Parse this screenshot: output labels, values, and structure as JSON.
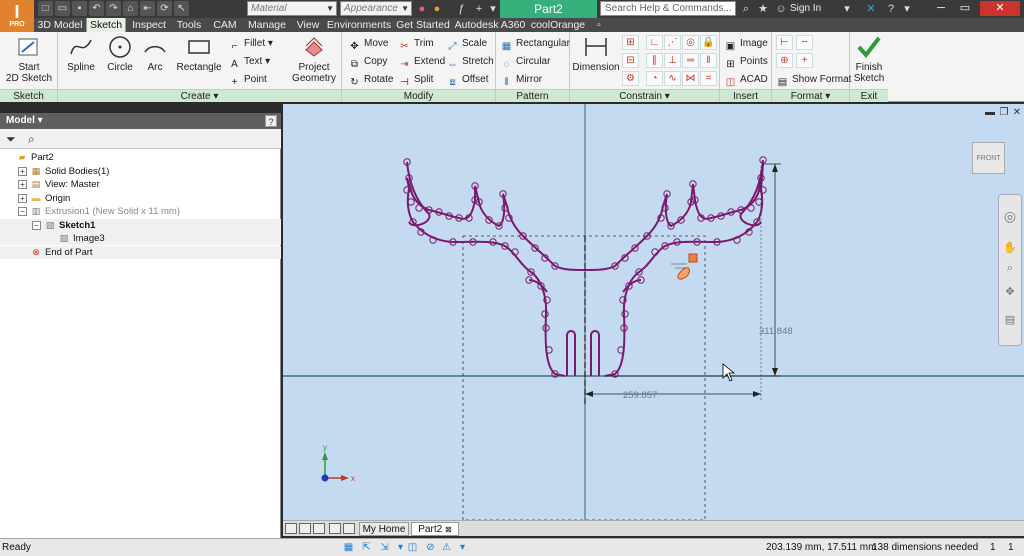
{
  "app": {
    "button_big": "I",
    "button_small": "PRO",
    "qat_icons": [
      "new-icon",
      "open-icon",
      "save-icon",
      "undo-icon",
      "redo-icon",
      "home-icon",
      "return-icon",
      "update-icon",
      "select-icon"
    ],
    "material_value": "Material",
    "appearance_value": "Appearance",
    "document_title": "Part2",
    "search_placeholder": "Search Help & Commands...",
    "sign_in_label": "Sign In"
  },
  "ribbon_tabs": [
    {
      "label": "3D Model"
    },
    {
      "label": "Sketch",
      "active": true
    },
    {
      "label": "Inspect"
    },
    {
      "label": "Tools"
    },
    {
      "label": "CAM"
    },
    {
      "label": "Manage"
    },
    {
      "label": "View"
    },
    {
      "label": "Environments"
    },
    {
      "label": "Get Started"
    },
    {
      "label": "Autodesk A360"
    },
    {
      "label": "coolOrange"
    }
  ],
  "ribbon": {
    "sketch_panel": {
      "label": "Sketch",
      "start_sketch_line1": "Start",
      "start_sketch_line2": "2D Sketch",
      "dropdown": "▾"
    },
    "create_panel": {
      "label": "Create ▾",
      "spline": "Spline",
      "circle": "Circle",
      "arc": "Arc",
      "rectangle": "Rectangle",
      "fillet": "Fillet",
      "text": "Text",
      "point": "Point",
      "project_geometry_line1": "Project",
      "project_geometry_line2": "Geometry"
    },
    "modify_panel": {
      "label": "Modify",
      "move": "Move",
      "copy": "Copy",
      "rotate": "Rotate",
      "trim": "Trim",
      "extend": "Extend",
      "split": "Split",
      "scale": "Scale",
      "stretch": "Stretch",
      "offset": "Offset"
    },
    "pattern_panel": {
      "label": "Pattern",
      "rectangular": "Rectangular",
      "circular": "Circular",
      "mirror": "Mirror"
    },
    "constrain_panel": {
      "label": "Constrain ▾",
      "dimension": "Dimension"
    },
    "insert_panel": {
      "label": "Insert",
      "image": "Image",
      "points": "Points",
      "acad": "ACAD"
    },
    "format_panel": {
      "label": "Format ▾",
      "show_format": "Show Format"
    },
    "exit_panel": {
      "label": "Exit",
      "finish_line1": "Finish",
      "finish_line2": "Sketch"
    }
  },
  "browser": {
    "title": "Model ▾",
    "help": "?",
    "tree": [
      {
        "label": "Part2",
        "icon": "part-icon",
        "indent": 0,
        "expander": ""
      },
      {
        "label": "Solid Bodies(1)",
        "icon": "solid-bodies-icon",
        "indent": 1,
        "expander": "+"
      },
      {
        "label": "View: Master",
        "icon": "view-icon",
        "indent": 1,
        "expander": "+"
      },
      {
        "label": "Origin",
        "icon": "folder-icon",
        "indent": 1,
        "expander": "+"
      },
      {
        "label": "Extrusion1 (New Solid x 11 mm)",
        "icon": "extrusion-icon",
        "indent": 1,
        "expander": "−",
        "muted": true
      },
      {
        "label": "Sketch1",
        "icon": "sketch-icon",
        "indent": 2,
        "expander": "−",
        "bold": true
      },
      {
        "label": "Image3",
        "icon": "image-icon",
        "indent": 3,
        "expander": ""
      },
      {
        "label": "End of Part",
        "icon": "end-of-part-icon",
        "indent": 1,
        "expander": ""
      }
    ]
  },
  "canvas": {
    "dim_vertical": "311.848",
    "dim_horizontal": "259.857",
    "viewcube_face": "FRONT",
    "axis_x": "x",
    "axis_y": "y"
  },
  "doc_tabs": [
    {
      "label": "My Home"
    },
    {
      "label": "Part2",
      "active": true,
      "close": "⊠"
    }
  ],
  "status": {
    "left": "Ready",
    "coordinates": "203.139 mm, 17.511 mm",
    "dimensions_needed": "138 dimensions needed",
    "count_1": "1",
    "count_2": "1"
  },
  "colors": {
    "accent_green": "#36b07b",
    "sketch_purple": "#7a1a6e",
    "canvas_bg": "#c4daf1",
    "app_orange": "#e0822e"
  }
}
